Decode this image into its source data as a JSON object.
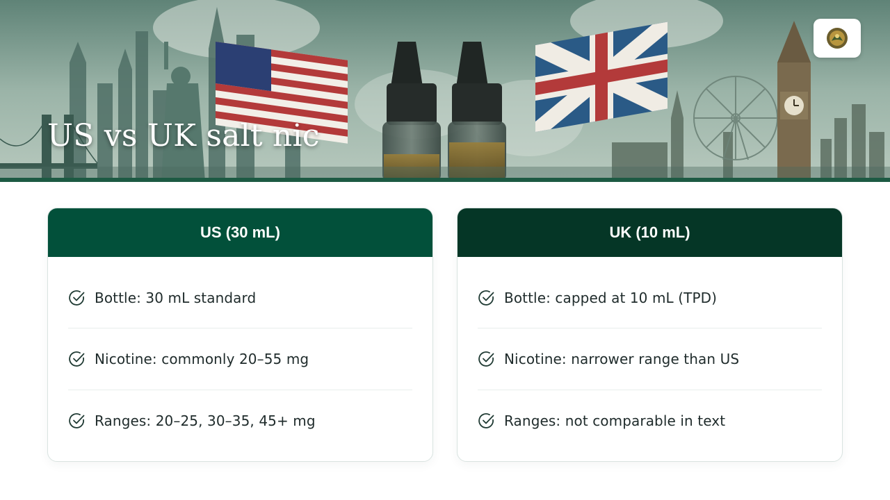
{
  "hero": {
    "title": "US vs UK salt nic",
    "image_icon": "us-uk-skyline-illustration",
    "logo_icon": "brand-crest-icon"
  },
  "colors": {
    "us_header": "#02503a",
    "uk_header": "#053626",
    "accent_bar": "#1d5a43",
    "check": "#1f3a33"
  },
  "cards": [
    {
      "title": "US (30 mL)",
      "items": [
        "Bottle: 30 mL standard",
        "Nicotine: commonly 20–55 mg",
        "Ranges: 20–25, 30–35, 45+ mg"
      ]
    },
    {
      "title": "UK (10 mL)",
      "items": [
        "Bottle: capped at 10 mL (TPD)",
        "Nicotine: narrower range than US",
        "Ranges: not comparable in text"
      ]
    }
  ]
}
